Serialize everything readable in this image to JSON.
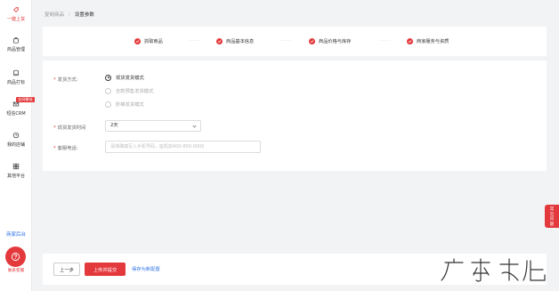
{
  "sidebar": {
    "items": [
      {
        "label": "一键上货",
        "icon": "tag-icon"
      },
      {
        "label": "商品管理",
        "icon": "bag-icon"
      },
      {
        "label": "商品打标",
        "icon": "tablet-icon"
      },
      {
        "label": "短信CRM",
        "icon": "mail-icon",
        "badge": "全网最低"
      },
      {
        "label": "我的店铺",
        "icon": "clock-icon"
      },
      {
        "label": "其他平台",
        "icon": "grid-icon"
      }
    ],
    "bottom_link": "商家后台",
    "service_label": "联系客服",
    "service_icon": "question-icon"
  },
  "breadcrumb": {
    "parent": "复制商品",
    "separator": "/",
    "current": "设置参数"
  },
  "steps": [
    {
      "label": "抓取商品",
      "done": true
    },
    {
      "label": "商品基本信息",
      "done": true
    },
    {
      "label": "商品价格与库存",
      "done": true
    },
    {
      "label": "商家服务与资质",
      "done": true
    }
  ],
  "step_separator": "·····",
  "form": {
    "delivery_mode": {
      "label": "发货方式:",
      "options": [
        "现货发货模式",
        "全款预售发货模式",
        "阶梯发货模式"
      ],
      "selected_index": 0
    },
    "delivery_time": {
      "label": "现货发货时间",
      "value": "2天"
    },
    "service_phone": {
      "label": "客服电话:",
      "placeholder": "请准确填写入手机号码，座机如400-800-0000"
    }
  },
  "float_tab_label": "常见问题",
  "footer": {
    "prev_label": "上一步",
    "submit_label": "上传并提交",
    "save_label": "保存为新配置"
  },
  "colors": {
    "accent": "#e4393c",
    "link": "#2f73e6",
    "background": "#f2f3f5"
  }
}
